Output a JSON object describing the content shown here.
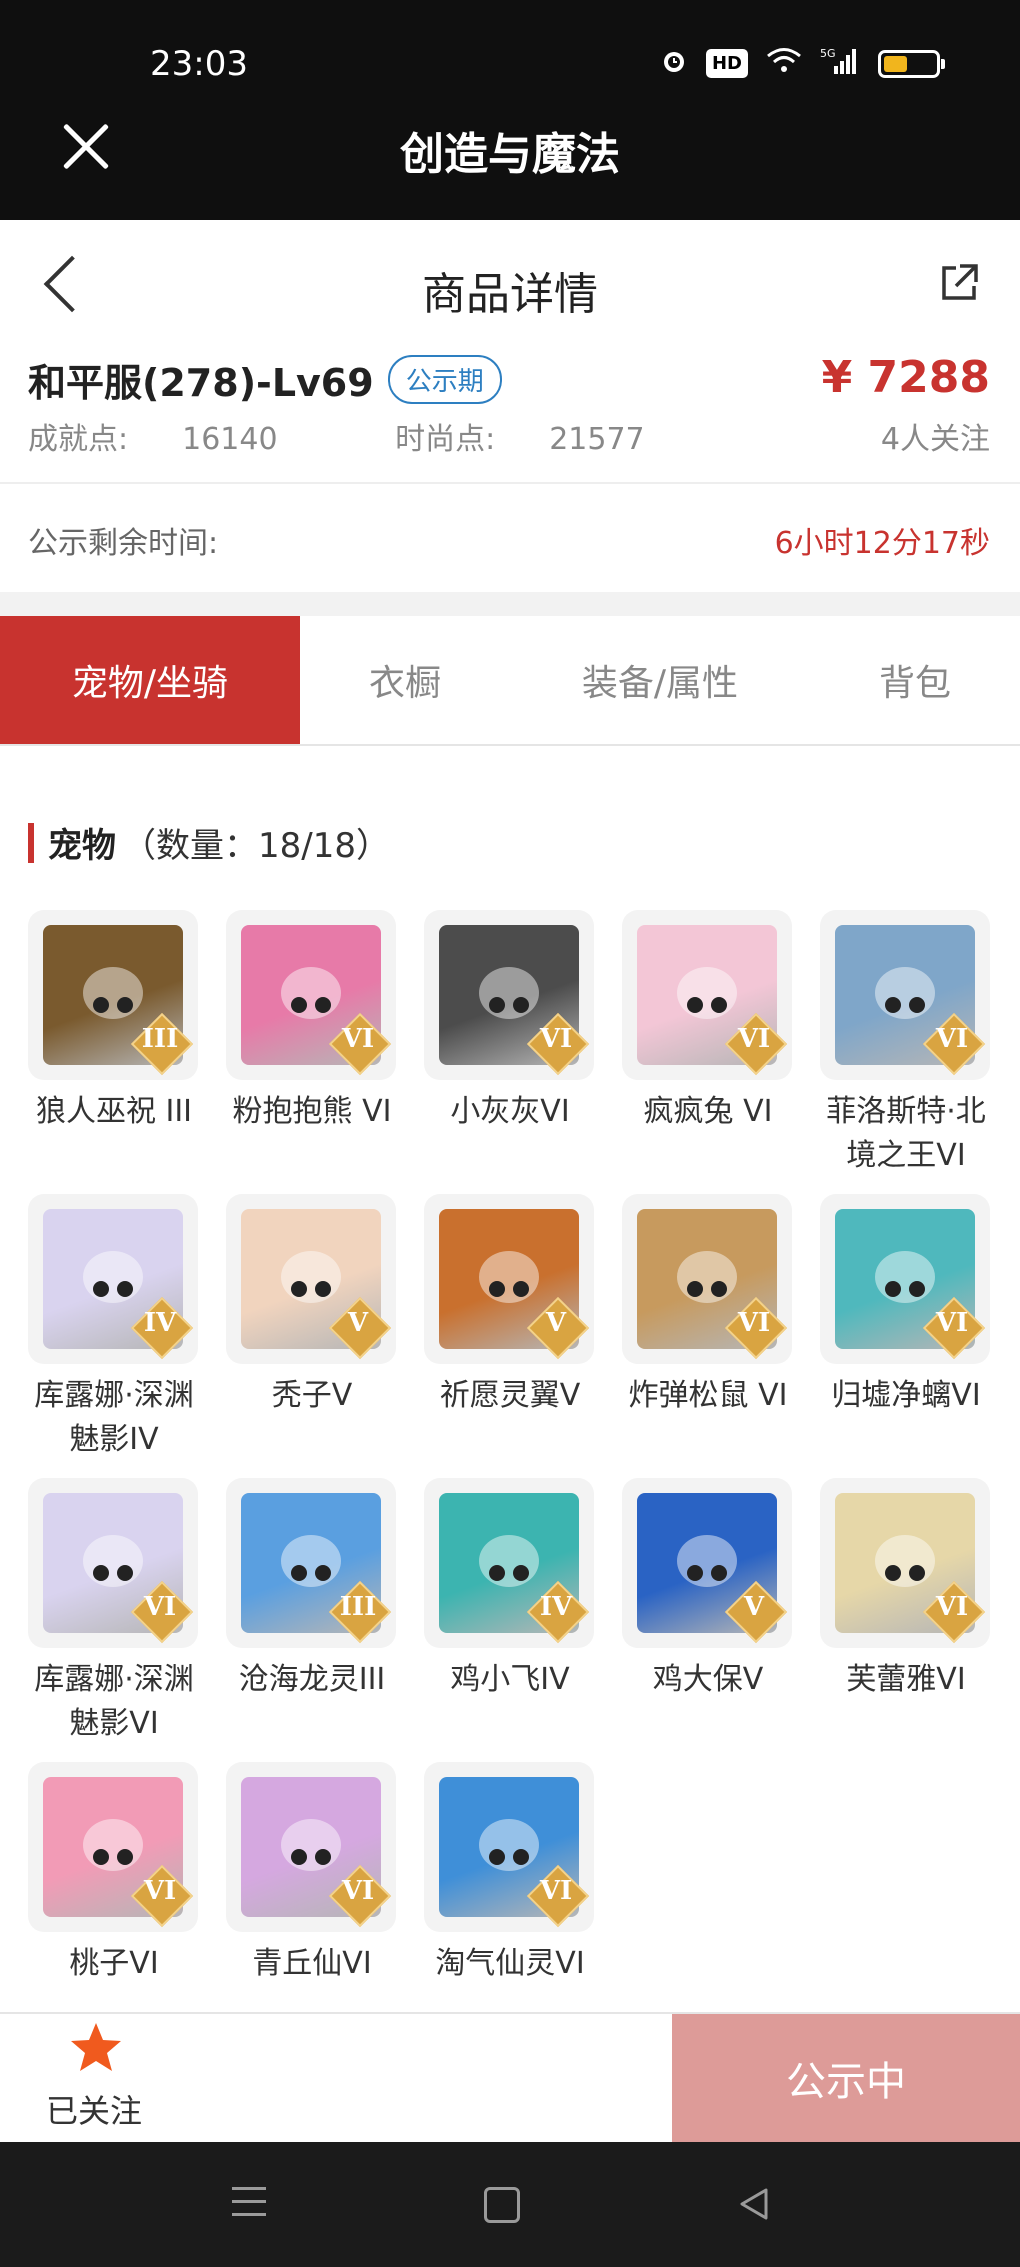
{
  "status_bar": {
    "time": "23:03",
    "icons": [
      "alarm-icon",
      "hd-icon",
      "wifi-icon",
      "5g-signal-icon",
      "battery-icon"
    ],
    "hd_label": "HD",
    "network_label": "5G",
    "battery_level": 0.45
  },
  "app": {
    "title": "创造与魔法",
    "close_icon": "close-icon"
  },
  "page": {
    "title": "商品详情",
    "back_icon": "back-arrow-icon",
    "share_icon": "share-icon"
  },
  "item": {
    "title": "和平服(278)-Lv69",
    "badge": "公示期",
    "price": "¥ 7288",
    "achievement_label": "成就点:",
    "achievement_value": "16140",
    "fashion_label": "时尚点:",
    "fashion_value": "21577",
    "followers": "4人关注",
    "remaining_label": "公示剩余时间:",
    "remaining_value": "6小时12分17秒"
  },
  "tabs": [
    {
      "label": "宠物/坐骑",
      "active": true
    },
    {
      "label": "衣橱",
      "active": false
    },
    {
      "label": "装备/属性",
      "active": false
    },
    {
      "label": "背包",
      "active": false
    }
  ],
  "section": {
    "name": "宠物",
    "count": "（数量：18/18）"
  },
  "pets": [
    {
      "name": "狼人巫祝 III",
      "grade": "III",
      "color": "#7a5a2e"
    },
    {
      "name": "粉抱抱熊 VI",
      "grade": "VI",
      "color": "#e77aa8"
    },
    {
      "name": "小灰灰VI",
      "grade": "VI",
      "color": "#4c4c4c"
    },
    {
      "name": "疯疯兔 VI",
      "grade": "VI",
      "color": "#f3c6d6"
    },
    {
      "name": "菲洛斯特·北境之王VI",
      "grade": "VI",
      "color": "#7fa6c9"
    },
    {
      "name": "库露娜·深渊魅影IV",
      "grade": "IV",
      "color": "#d9d3ef"
    },
    {
      "name": "秃子V",
      "grade": "V",
      "color": "#f1d4be"
    },
    {
      "name": "祈愿灵翼V",
      "grade": "V",
      "color": "#c9702e"
    },
    {
      "name": "炸弹松鼠 VI",
      "grade": "VI",
      "color": "#c79a5e"
    },
    {
      "name": "归墟净螭VI",
      "grade": "VI",
      "color": "#4fb8bd"
    },
    {
      "name": "库露娜·深渊魅影VI",
      "grade": "VI",
      "color": "#d9d3ef"
    },
    {
      "name": "沧海龙灵III",
      "grade": "III",
      "color": "#5a9fe0"
    },
    {
      "name": "鸡小飞IV",
      "grade": "IV",
      "color": "#3cb4b0"
    },
    {
      "name": "鸡大保V",
      "grade": "V",
      "color": "#2a63c4"
    },
    {
      "name": "芙蕾雅VI",
      "grade": "VI",
      "color": "#e6d7a8"
    },
    {
      "name": "桃子VI",
      "grade": "VI",
      "color": "#f29bb6"
    },
    {
      "name": "青丘仙VI",
      "grade": "VI",
      "color": "#d5a8e0"
    },
    {
      "name": "淘气仙灵VI",
      "grade": "VI",
      "color": "#3f8fd8"
    }
  ],
  "bottom": {
    "follow_label": "已关注",
    "follow_icon": "star-icon",
    "status_button": "公示中"
  },
  "system_nav": [
    "menu-icon",
    "home-icon",
    "back-icon"
  ],
  "colors": {
    "accent": "#c8332f",
    "badge": "#2d7fc1",
    "status_button": "#dd9b98",
    "star": "#f05a1e"
  }
}
